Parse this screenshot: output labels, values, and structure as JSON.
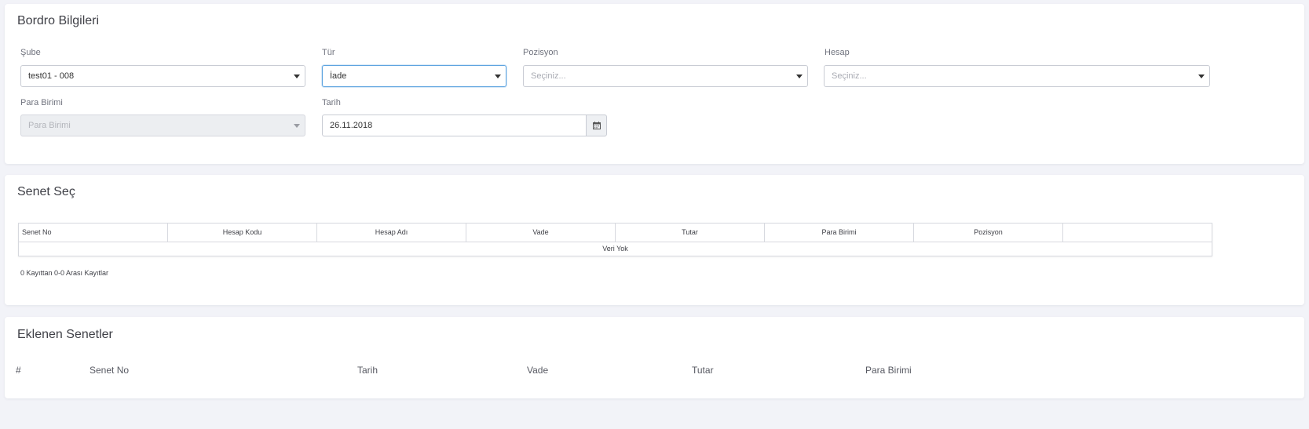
{
  "bordro": {
    "title": "Bordro Bilgileri",
    "sube": {
      "label": "Şube",
      "value": "test01 - 008"
    },
    "tur": {
      "label": "Tür",
      "value": "İade"
    },
    "pozisyon": {
      "label": "Pozisyon",
      "placeholder": "Seçiniz..."
    },
    "hesap": {
      "label": "Hesap",
      "placeholder": "Seçiniz..."
    },
    "para_birimi": {
      "label": "Para Birimi",
      "placeholder": "Para Birimi"
    },
    "tarih": {
      "label": "Tarih",
      "value": "26.11.2018"
    }
  },
  "senet_sec": {
    "title": "Senet Seç",
    "columns": [
      "Senet No",
      "Hesap Kodu",
      "Hesap Adı",
      "Vade",
      "Tutar",
      "Para Birimi",
      "Pozisyon",
      ""
    ],
    "empty_text": "Veri Yok",
    "info": "0 Kayıttan 0-0 Arası Kayıtlar"
  },
  "eklenen": {
    "title": "Eklenen Senetler",
    "columns": [
      "#",
      "Senet No",
      "Tarih",
      "Vade",
      "Tutar",
      "Para Birimi"
    ]
  },
  "icons": {
    "dropdown": "caret-down-icon",
    "calendar": "calendar-icon"
  },
  "colors": {
    "background": "#f2f3f8",
    "card": "#ffffff",
    "focus_border": "#5ea4e0"
  }
}
